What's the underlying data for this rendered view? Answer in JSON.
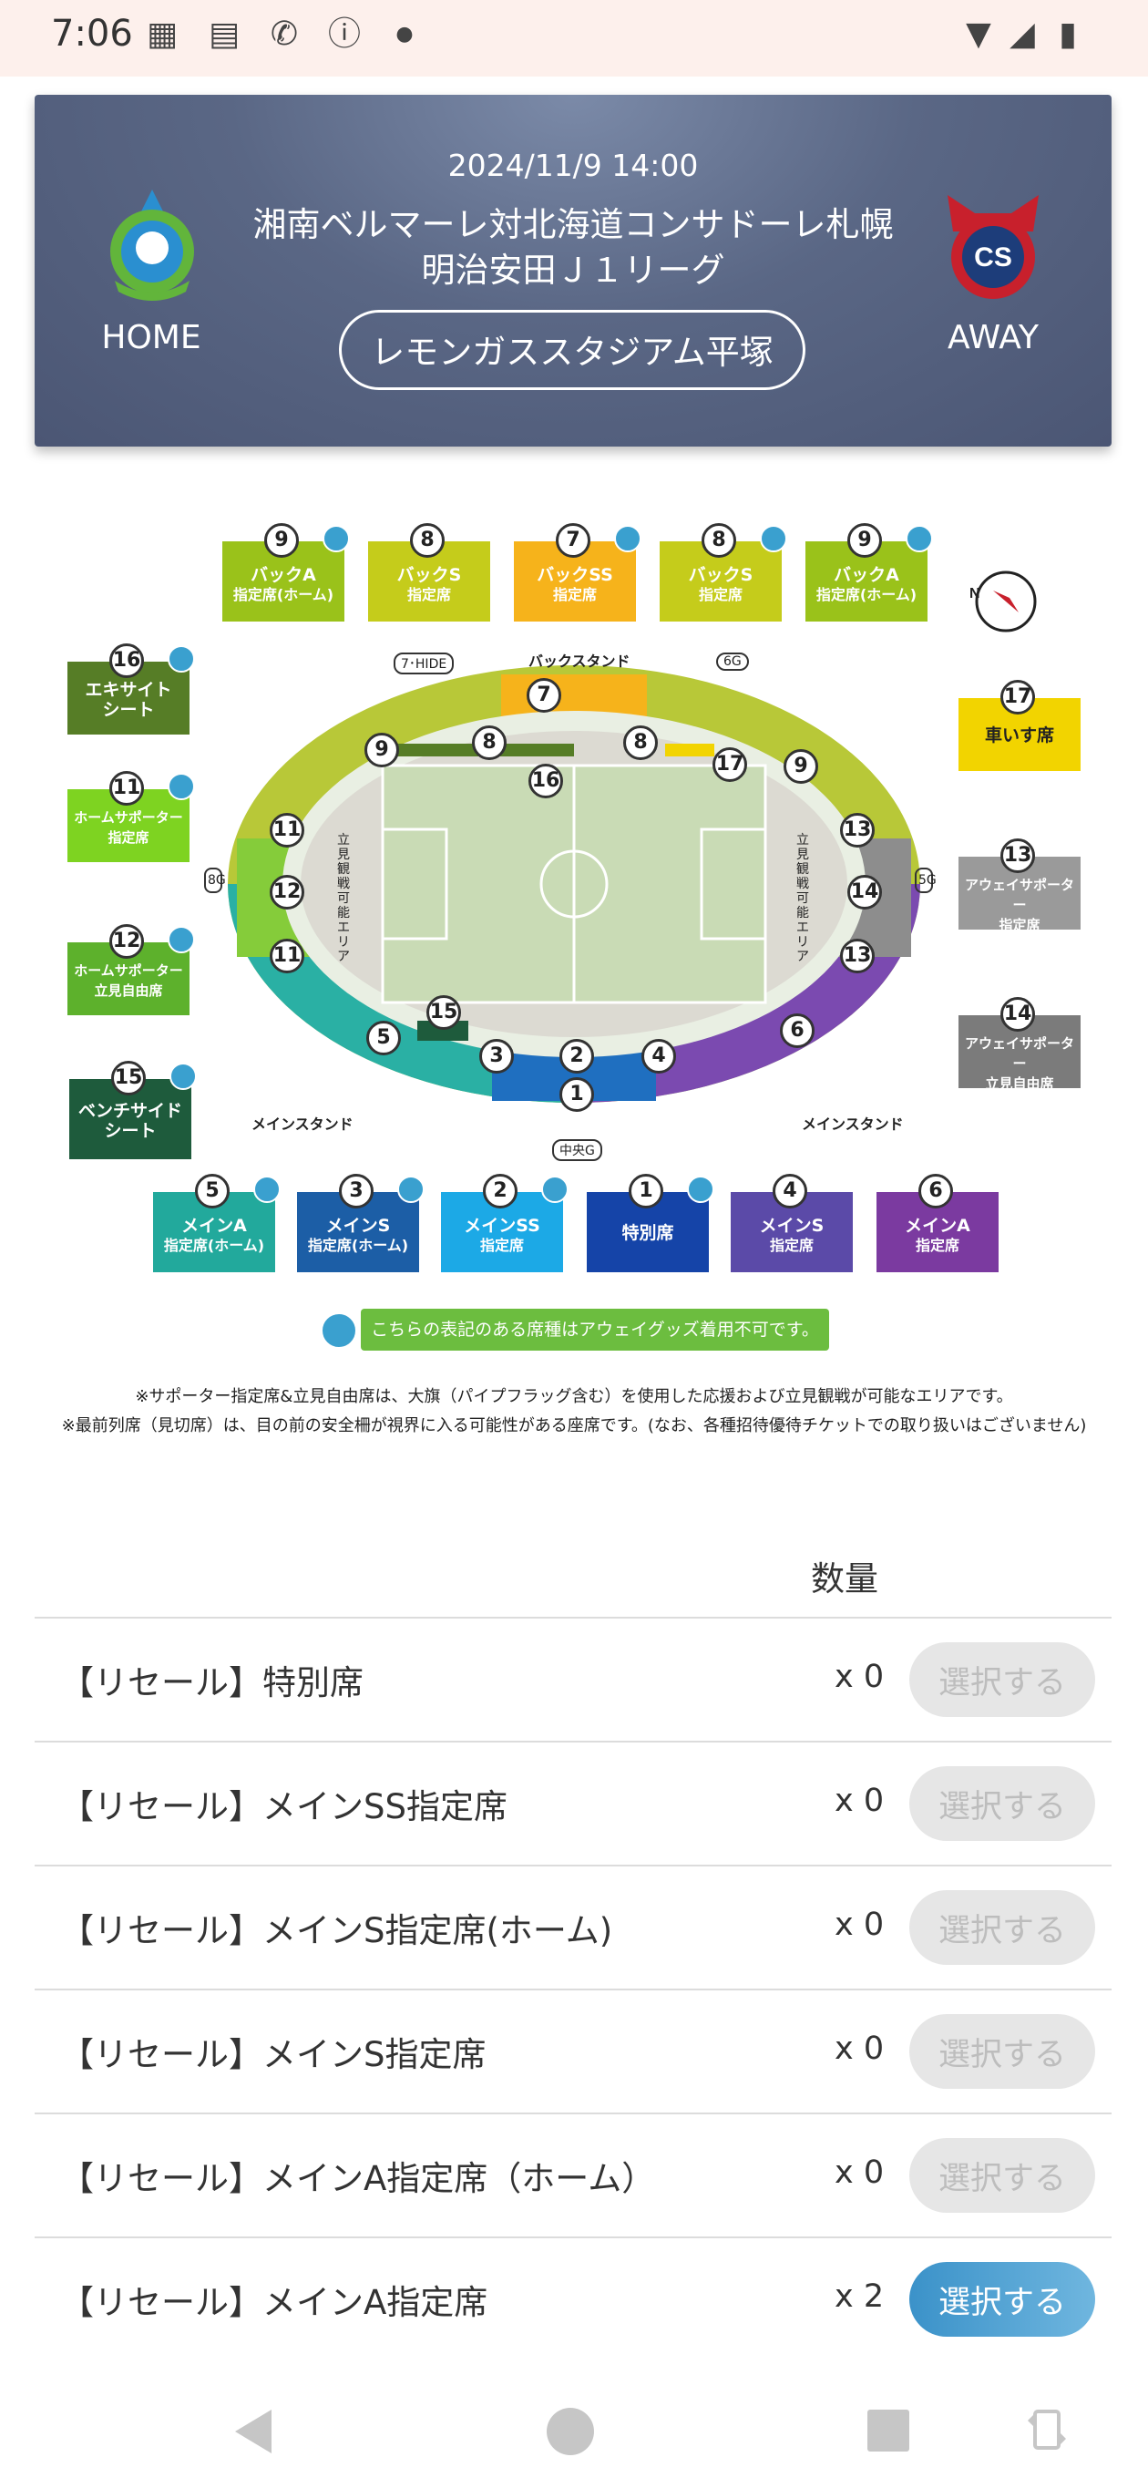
{
  "status_bar": {
    "time": "7:06"
  },
  "header": {
    "date": "2024/11/9 14:00",
    "title_line1": "湘南ベルマーレ対北海道コンサドーレ札幌",
    "title_line2": "明治安田Ｊ１リーグ",
    "venue": "レモンガススタジアム平塚",
    "home_label": "HOME",
    "away_label": "AWAY"
  },
  "seat_map": {
    "top_tiles": [
      {
        "num": "9",
        "line1": "バックA",
        "line2": "指定席(ホーム)",
        "color": "#9ac21a"
      },
      {
        "num": "8",
        "line1": "バックS",
        "line2": "指定席",
        "color": "#c5cc1b"
      },
      {
        "num": "7",
        "line1": "バックSS",
        "line2": "指定席",
        "color": "#f6b31b"
      },
      {
        "num": "8",
        "line1": "バックS",
        "line2": "指定席",
        "color": "#c5cc1b"
      },
      {
        "num": "9",
        "line1": "バックA",
        "line2": "指定席(ホーム)",
        "color": "#9ac21a"
      }
    ],
    "left_tiles": [
      {
        "num": "16",
        "line1": "エキサイト",
        "line2": "シート",
        "color": "#567d26"
      },
      {
        "num": "11",
        "line1": "ホームサポーター",
        "line2": "指定席",
        "color": "#7ed321"
      },
      {
        "num": "12",
        "line1": "ホームサポーター",
        "line2": "立見自由席",
        "color": "#5db12c"
      },
      {
        "num": "15",
        "line1": "ベンチサイド",
        "line2": "シート",
        "color": "#1e5b3c"
      }
    ],
    "right_tiles": [
      {
        "num": "17",
        "line1": "車いす席",
        "line2": "",
        "color": "#f2d400",
        "text": "#222"
      },
      {
        "num": "13",
        "line1": "アウェイサポーター",
        "line2": "指定席",
        "color": "#9a9a9a",
        "text": "#fff"
      },
      {
        "num": "14",
        "line1": "アウェイサポーター",
        "line2": "立見自由席",
        "color": "#7b7b7b",
        "text": "#fff"
      }
    ],
    "bottom_tiles": [
      {
        "num": "5",
        "line1": "メインA",
        "line2": "指定席(ホーム)",
        "color": "#22a99c"
      },
      {
        "num": "3",
        "line1": "メインS",
        "line2": "指定席(ホーム)",
        "color": "#1c5ea6"
      },
      {
        "num": "2",
        "line1": "メインSS",
        "line2": "指定席",
        "color": "#1ca9e6"
      },
      {
        "num": "1",
        "line1": "特別席",
        "line2": "",
        "color": "#1544a8"
      },
      {
        "num": "4",
        "line1": "メインS",
        "line2": "指定席",
        "color": "#5b4aa8"
      },
      {
        "num": "6",
        "line1": "メインA",
        "line2": "指定席",
        "color": "#7b3aa0"
      }
    ],
    "labels": {
      "back_stand": "バックスタンド",
      "main_stand_left": "メインスタンド",
      "main_stand_right": "メインスタンド",
      "gate_7hide": "7･HIDE",
      "gate_6g": "6G",
      "gate_8g": "8G",
      "gate_5g": "5G",
      "gate_center": "中央G",
      "standing_area": "立見観戦可能エリア"
    },
    "notice": "こちらの表記のある席種はアウェイグッズ着用不可です。",
    "note1": "※サポーター指定席&立見自由席は、大旗（パイプフラッグ含む）を使用した応援および立見観戦が可能なエリアです。",
    "note2": "※最前列席（見切席）は、目の前の安全柵が視界に入る可能性がある座席です。(なお、各種招待優待チケットでの取り扱いはございません)"
  },
  "quantity": {
    "header": "数量",
    "rows": [
      {
        "label": "【リセール】特別席",
        "qty": "x 0",
        "button": "選択する",
        "enabled": false
      },
      {
        "label": "【リセール】メインSS指定席",
        "qty": "x 0",
        "button": "選択する",
        "enabled": false
      },
      {
        "label": "【リセール】メインS指定席(ホーム)",
        "qty": "x 0",
        "button": "選択する",
        "enabled": false
      },
      {
        "label": "【リセール】メインS指定席",
        "qty": "x 0",
        "button": "選択する",
        "enabled": false
      },
      {
        "label": "【リセール】メインA指定席（ホーム）",
        "qty": "x 0",
        "button": "選択する",
        "enabled": false
      },
      {
        "label": "【リセール】メインA指定席",
        "qty": "x 2",
        "button": "選択する",
        "enabled": true
      }
    ]
  },
  "nav_bar": {
    "icons": [
      "back-icon",
      "home-icon",
      "recents-icon",
      "rotate-icon"
    ]
  }
}
